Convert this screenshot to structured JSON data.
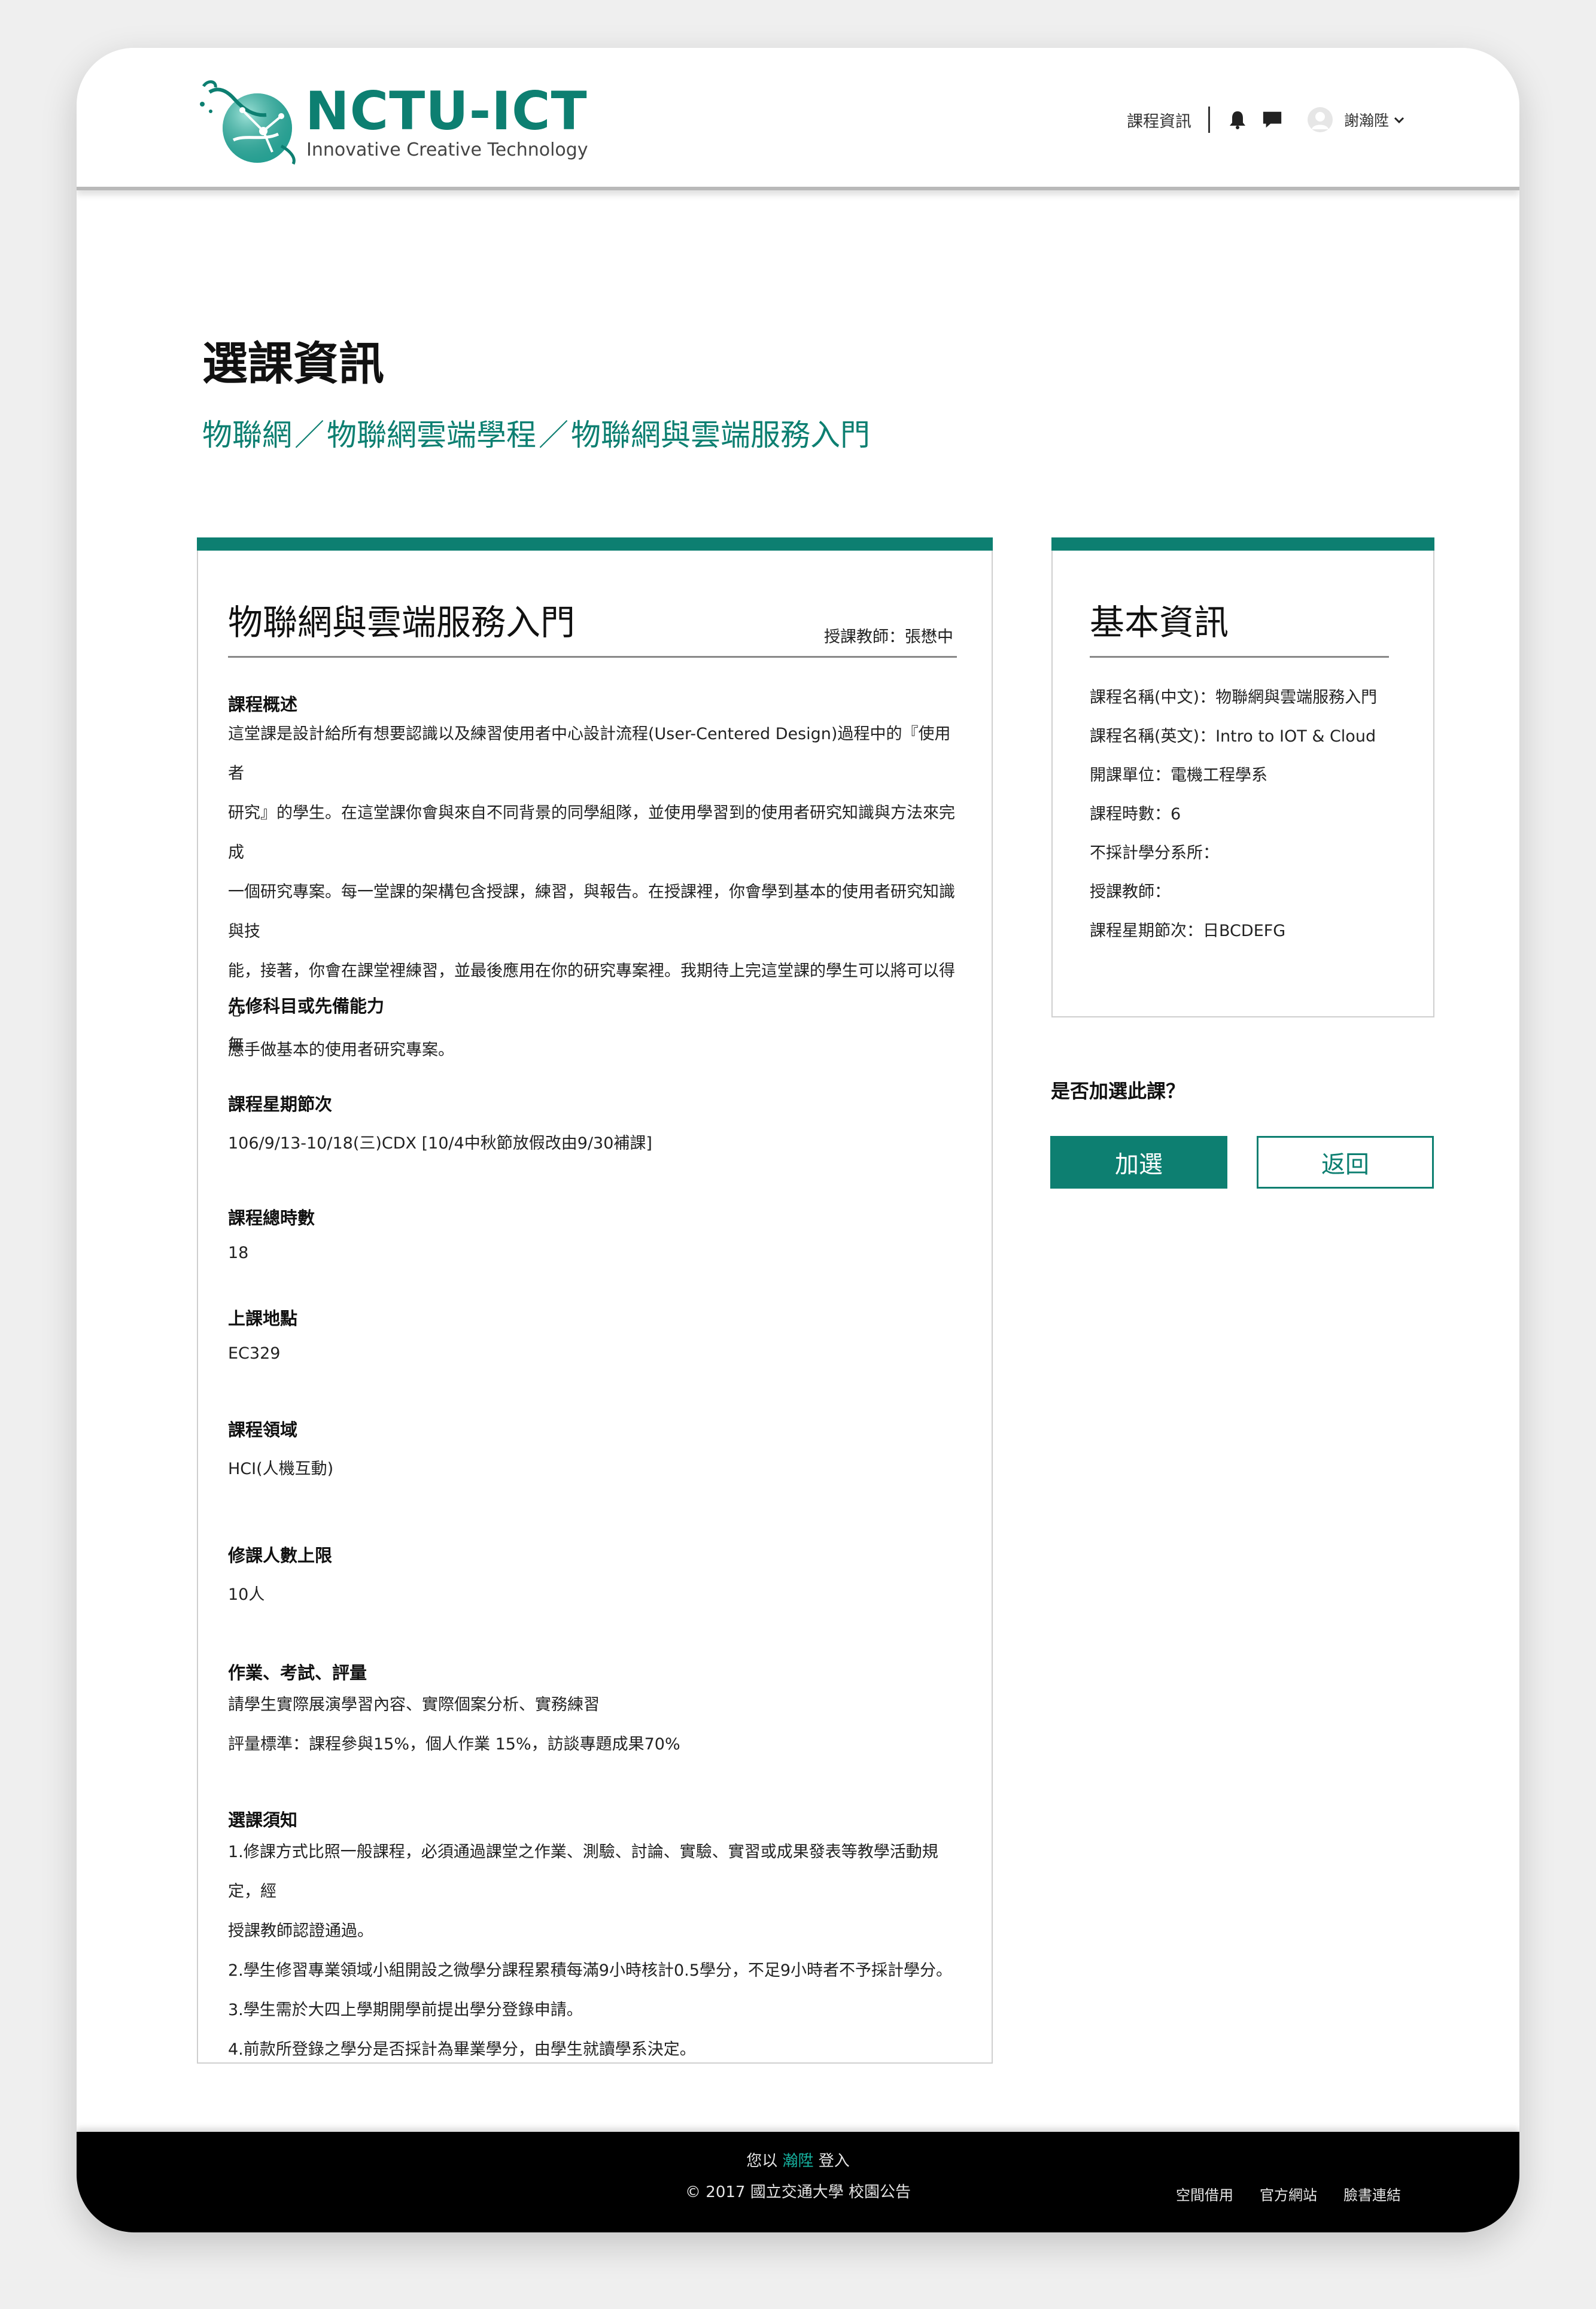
{
  "colors": {
    "accent": "#0d7f71",
    "footer_bg": "#000000",
    "footer_user": "#16b3a0"
  },
  "header": {
    "logo_title": "NCTU-ICT",
    "logo_subtitle": "Innovative Creative Technology",
    "nav_link": "課程資訊",
    "icons": [
      "bell-icon",
      "chat-icon",
      "avatar-icon",
      "chevron-down-icon"
    ],
    "user_name": "謝瀚陞"
  },
  "page": {
    "title": "選課資訊",
    "breadcrumb": [
      "物聯網",
      "物聯網雲端學程",
      "物聯網與雲端服務入門"
    ],
    "breadcrumb_separator": "／"
  },
  "course": {
    "title": "物聯網與雲端服務入門",
    "teacher": "授課教師：張懋中",
    "sections": {
      "overview": {
        "title": "課程概述",
        "lines": [
          "這堂課是設計給所有想要認識以及練習使用者中心設計流程(User-Centered Design)過程中的『使用者",
          "研究』的學生。在這堂課你會與來自不同背景的同學組隊，並使用學習到的使用者研究知識與方法來完成",
          "一個研究專案。每一堂課的架構包含授課，練習，與報告。在授課裡，你會學到基本的使用者研究知識與技",
          "能，接著，你會在課堂裡練習，並最後應用在你的研究專案裡。我期待上完這堂課的學生可以將可以得心",
          "應手做基本的使用者研究專案。"
        ]
      },
      "prerequisite": {
        "title": "先修科目或先備能力",
        "text": "無"
      },
      "schedule": {
        "title": "課程星期節次",
        "text": "106/9/13-10/18(三)CDX [10/4中秋節放假改由9/30補課]"
      },
      "hours": {
        "title": "課程總時數",
        "text": "18"
      },
      "location": {
        "title": "上課地點",
        "text": "EC329"
      },
      "field": {
        "title": "課程領域",
        "text": "HCI(人機互動)"
      },
      "capacity": {
        "title": "修課人數上限",
        "text": "10人"
      },
      "grading": {
        "title": "作業、考試、評量",
        "lines": [
          "請學生實際展演學習內容、實際個案分析、實務練習",
          "評量標準：課程參與15%，個人作業 15%，訪談專題成果70%"
        ]
      },
      "notice": {
        "title": "選課須知",
        "lines": [
          "1.修課方式比照一般課程，必須通過課堂之作業、測驗、討論、實驗、實習或成果發表等教學活動規定，經",
          "授課教師認證通過。",
          "2.學生修習專業領域小組開設之微學分課程累積每滿9小時核計0.5學分，不足9小時者不予採計學分。",
          "3.學生需於大四上學期開學前提出學分登錄申請。",
          "4.前款所登錄之學分是否採計為畢業學分，由學生就讀學系決定。"
        ]
      }
    }
  },
  "sidebar": {
    "title": "基本資訊",
    "items": [
      "課程名稱(中文)：物聯網與雲端服務入門",
      "課程名稱(英文)：Intro to IOT & Cloud",
      "開課單位：電機工程學系",
      "課程時數：6",
      "不採計學分系所：",
      "授課教師：",
      "課程星期節次：日BCDEFG"
    ],
    "prompt": "是否加選此課？",
    "add_label": "加選",
    "back_label": "返回"
  },
  "footer": {
    "login_prefix": "您以",
    "login_user": "瀚陞",
    "login_suffix": "登入",
    "copyright": "© 2017 國立交通大學 校園公告",
    "links": [
      "空間借用",
      "官方網站",
      "臉書連結"
    ]
  }
}
